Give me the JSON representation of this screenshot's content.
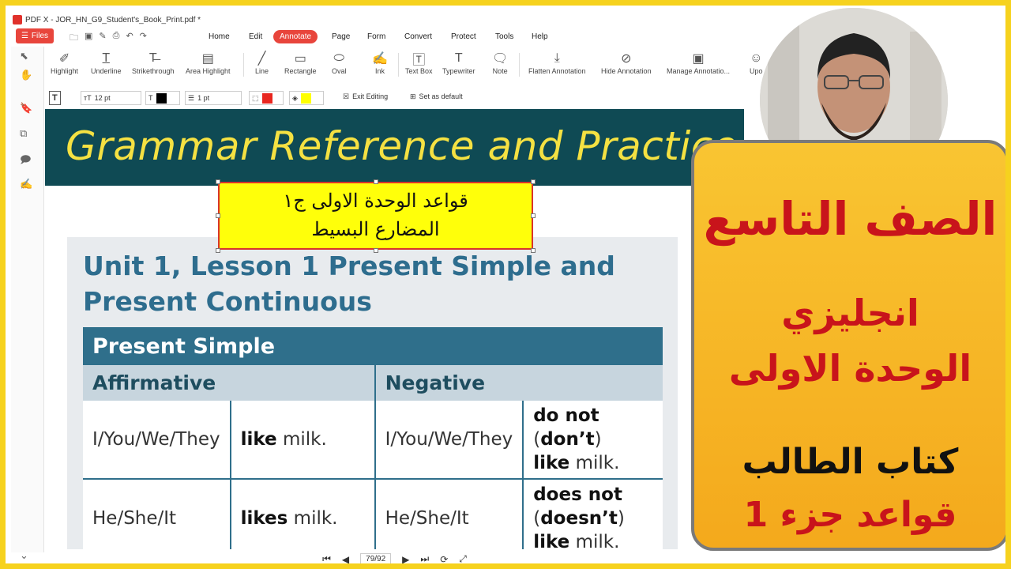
{
  "app": {
    "title": "PDF X - JOR_HN_G9_Student's_Book_Print.pdf *",
    "files_label": "Files"
  },
  "menu": [
    "Home",
    "Edit",
    "Annotate",
    "Page",
    "Form",
    "Convert",
    "Protect",
    "Tools",
    "Help"
  ],
  "ribbon": {
    "tools": [
      "Highlight",
      "Underline",
      "Strikethrough",
      "Area Highlight",
      "Line",
      "Rectangle",
      "Oval",
      "Ink",
      "Text Box",
      "Typewriter",
      "Note",
      "Flatten Annotation",
      "Hide Annotation",
      "Manage Annotatio...",
      "Upo"
    ]
  },
  "propbar": {
    "font_size": "12 pt",
    "line_width": "1 pt",
    "exit_label": "Exit Editing",
    "default_label": "Set as default",
    "text_color": "#000000",
    "stroke_color": "#e8261f",
    "fill_color": "#ffff00"
  },
  "doc": {
    "banner_title": "Grammar Reference and Practice",
    "note_line1": "قواعد الوحدة الاولى ج١",
    "note_line2": "المضارع البسيط",
    "lesson_title": "Unit 1, Lesson 1 Present Simple and Present Continuous",
    "table": {
      "header": "Present Simple",
      "col_affirmative": "Affirmative",
      "col_negative": "Negative",
      "rows": [
        {
          "subj1": "I/You/We/They",
          "verb": "like",
          "rest": " milk.",
          "subj2": "I/You/We/They",
          "neg_a": "do not",
          "neg_b": " (",
          "neg_c": "don’t",
          "neg_d": ")",
          "neg_verb": "like",
          "neg_rest": " milk."
        },
        {
          "subj1": "He/She/It",
          "verb": "likes",
          "rest": " milk.",
          "subj2": "He/She/It",
          "neg_a": "does not",
          "neg_b": "(",
          "neg_c": "doesn’t",
          "neg_d": ")",
          "neg_verb": "like",
          "neg_rest": " milk."
        }
      ]
    }
  },
  "nav": {
    "page_indicator": "79/92"
  },
  "overlay": {
    "line1": "الصف التاسع",
    "line2": "انجليزي",
    "line3": "الوحدة الاولى",
    "line4": "كتاب الطالب",
    "line5": "قواعد جزء 1",
    "card_color": "#f6b522",
    "red_text": "#c8141b"
  }
}
